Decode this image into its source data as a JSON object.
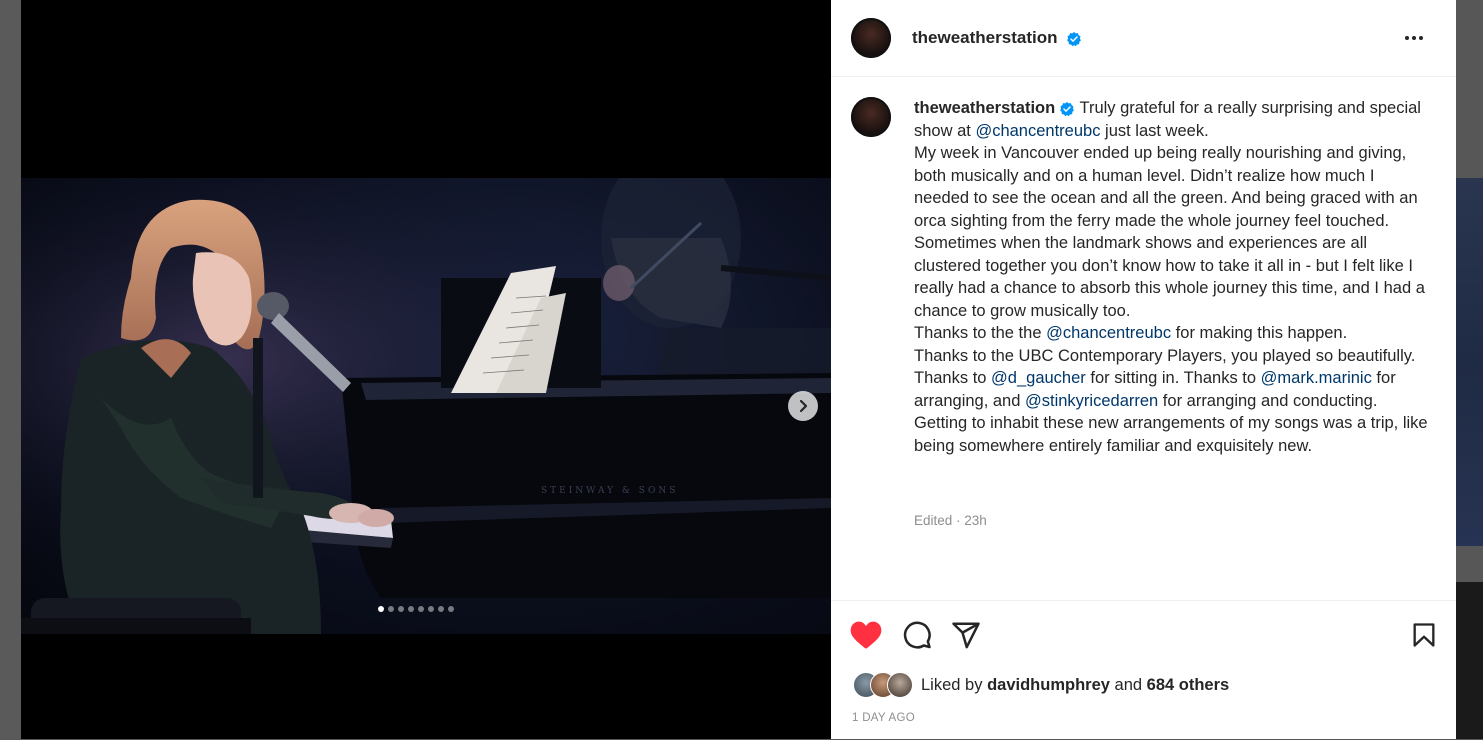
{
  "post": {
    "username": "theweatherstation",
    "caption": {
      "username": "theweatherstation",
      "t1": " Truly grateful for a really surprising and special show at ",
      "m1": "@chancentreubc",
      "t2": " just last week.",
      "p2": "My week in Vancouver ended up being really nourishing and giving, both musically and on a human level. Didn’t realize how much I needed to see the ocean and all the green. And being graced with an orca sighting from the ferry made the whole journey feel touched.",
      "p3": "Sometimes when the landmark shows and experiences are all clustered together you don’t know how to take it all in - but I felt like I really had a chance to absorb this whole journey this time, and I had a chance to grow musically too.",
      "t3": "Thanks to the the ",
      "m2": "@chancentreubc",
      "t4": " for making this happen.",
      "t5": "Thanks to the UBC Contemporary Players, you played so beautifully. Thanks to ",
      "m3": "@d_gaucher",
      "t6": " for sitting in. Thanks to ",
      "m4": "@mark.marinic",
      "t7": " for arranging, and ",
      "m5": "@stinkyricedarren",
      "t8": " for arranging and conducting. Getting to inhabit these new arrangements of my songs was a trip, like being somewhere entirely familiar and exquisitely new."
    },
    "meta": "Edited · 23h",
    "likes": {
      "prefix": "Liked by ",
      "user": "davidhumphrey",
      "and": " and ",
      "others": "684 others"
    },
    "time": "1 DAY AGO",
    "carousel_count": 8,
    "carousel_active": 1
  },
  "icons": [
    "verified-badge-icon",
    "more-options-icon",
    "heart-filled-icon",
    "comment-icon",
    "share-icon",
    "bookmark-icon",
    "chevron-right-icon"
  ],
  "colors": {
    "heart": "#ff3040",
    "verified": "#0095f6",
    "mention": "#00376b",
    "muted": "#8e8e8e"
  }
}
